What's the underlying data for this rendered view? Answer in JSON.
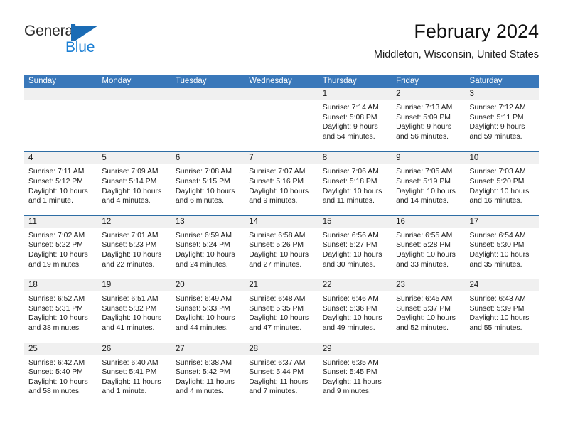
{
  "brand": {
    "word_one": "General",
    "word_two": "Blue",
    "mark": "triangle-logo",
    "accent_color": "#1b6cb5"
  },
  "header": {
    "title": "February 2024",
    "location": "Middleton, Wisconsin, United States"
  },
  "theme": {
    "header_blue": "#3a78ba",
    "rule_blue": "#2e6da4",
    "daynum_band": "#f0f0f0"
  },
  "weekdays": [
    "Sunday",
    "Monday",
    "Tuesday",
    "Wednesday",
    "Thursday",
    "Friday",
    "Saturday"
  ],
  "weeks": [
    [
      {
        "day": "",
        "sunrise": "",
        "sunset": "",
        "daylight_a": "",
        "daylight_b": ""
      },
      {
        "day": "",
        "sunrise": "",
        "sunset": "",
        "daylight_a": "",
        "daylight_b": ""
      },
      {
        "day": "",
        "sunrise": "",
        "sunset": "",
        "daylight_a": "",
        "daylight_b": ""
      },
      {
        "day": "",
        "sunrise": "",
        "sunset": "",
        "daylight_a": "",
        "daylight_b": ""
      },
      {
        "day": "1",
        "sunrise": "Sunrise: 7:14 AM",
        "sunset": "Sunset: 5:08 PM",
        "daylight_a": "Daylight: 9 hours",
        "daylight_b": "and 54 minutes."
      },
      {
        "day": "2",
        "sunrise": "Sunrise: 7:13 AM",
        "sunset": "Sunset: 5:09 PM",
        "daylight_a": "Daylight: 9 hours",
        "daylight_b": "and 56 minutes."
      },
      {
        "day": "3",
        "sunrise": "Sunrise: 7:12 AM",
        "sunset": "Sunset: 5:11 PM",
        "daylight_a": "Daylight: 9 hours",
        "daylight_b": "and 59 minutes."
      }
    ],
    [
      {
        "day": "4",
        "sunrise": "Sunrise: 7:11 AM",
        "sunset": "Sunset: 5:12 PM",
        "daylight_a": "Daylight: 10 hours",
        "daylight_b": "and 1 minute."
      },
      {
        "day": "5",
        "sunrise": "Sunrise: 7:09 AM",
        "sunset": "Sunset: 5:14 PM",
        "daylight_a": "Daylight: 10 hours",
        "daylight_b": "and 4 minutes."
      },
      {
        "day": "6",
        "sunrise": "Sunrise: 7:08 AM",
        "sunset": "Sunset: 5:15 PM",
        "daylight_a": "Daylight: 10 hours",
        "daylight_b": "and 6 minutes."
      },
      {
        "day": "7",
        "sunrise": "Sunrise: 7:07 AM",
        "sunset": "Sunset: 5:16 PM",
        "daylight_a": "Daylight: 10 hours",
        "daylight_b": "and 9 minutes."
      },
      {
        "day": "8",
        "sunrise": "Sunrise: 7:06 AM",
        "sunset": "Sunset: 5:18 PM",
        "daylight_a": "Daylight: 10 hours",
        "daylight_b": "and 11 minutes."
      },
      {
        "day": "9",
        "sunrise": "Sunrise: 7:05 AM",
        "sunset": "Sunset: 5:19 PM",
        "daylight_a": "Daylight: 10 hours",
        "daylight_b": "and 14 minutes."
      },
      {
        "day": "10",
        "sunrise": "Sunrise: 7:03 AM",
        "sunset": "Sunset: 5:20 PM",
        "daylight_a": "Daylight: 10 hours",
        "daylight_b": "and 16 minutes."
      }
    ],
    [
      {
        "day": "11",
        "sunrise": "Sunrise: 7:02 AM",
        "sunset": "Sunset: 5:22 PM",
        "daylight_a": "Daylight: 10 hours",
        "daylight_b": "and 19 minutes."
      },
      {
        "day": "12",
        "sunrise": "Sunrise: 7:01 AM",
        "sunset": "Sunset: 5:23 PM",
        "daylight_a": "Daylight: 10 hours",
        "daylight_b": "and 22 minutes."
      },
      {
        "day": "13",
        "sunrise": "Sunrise: 6:59 AM",
        "sunset": "Sunset: 5:24 PM",
        "daylight_a": "Daylight: 10 hours",
        "daylight_b": "and 24 minutes."
      },
      {
        "day": "14",
        "sunrise": "Sunrise: 6:58 AM",
        "sunset": "Sunset: 5:26 PM",
        "daylight_a": "Daylight: 10 hours",
        "daylight_b": "and 27 minutes."
      },
      {
        "day": "15",
        "sunrise": "Sunrise: 6:56 AM",
        "sunset": "Sunset: 5:27 PM",
        "daylight_a": "Daylight: 10 hours",
        "daylight_b": "and 30 minutes."
      },
      {
        "day": "16",
        "sunrise": "Sunrise: 6:55 AM",
        "sunset": "Sunset: 5:28 PM",
        "daylight_a": "Daylight: 10 hours",
        "daylight_b": "and 33 minutes."
      },
      {
        "day": "17",
        "sunrise": "Sunrise: 6:54 AM",
        "sunset": "Sunset: 5:30 PM",
        "daylight_a": "Daylight: 10 hours",
        "daylight_b": "and 35 minutes."
      }
    ],
    [
      {
        "day": "18",
        "sunrise": "Sunrise: 6:52 AM",
        "sunset": "Sunset: 5:31 PM",
        "daylight_a": "Daylight: 10 hours",
        "daylight_b": "and 38 minutes."
      },
      {
        "day": "19",
        "sunrise": "Sunrise: 6:51 AM",
        "sunset": "Sunset: 5:32 PM",
        "daylight_a": "Daylight: 10 hours",
        "daylight_b": "and 41 minutes."
      },
      {
        "day": "20",
        "sunrise": "Sunrise: 6:49 AM",
        "sunset": "Sunset: 5:33 PM",
        "daylight_a": "Daylight: 10 hours",
        "daylight_b": "and 44 minutes."
      },
      {
        "day": "21",
        "sunrise": "Sunrise: 6:48 AM",
        "sunset": "Sunset: 5:35 PM",
        "daylight_a": "Daylight: 10 hours",
        "daylight_b": "and 47 minutes."
      },
      {
        "day": "22",
        "sunrise": "Sunrise: 6:46 AM",
        "sunset": "Sunset: 5:36 PM",
        "daylight_a": "Daylight: 10 hours",
        "daylight_b": "and 49 minutes."
      },
      {
        "day": "23",
        "sunrise": "Sunrise: 6:45 AM",
        "sunset": "Sunset: 5:37 PM",
        "daylight_a": "Daylight: 10 hours",
        "daylight_b": "and 52 minutes."
      },
      {
        "day": "24",
        "sunrise": "Sunrise: 6:43 AM",
        "sunset": "Sunset: 5:39 PM",
        "daylight_a": "Daylight: 10 hours",
        "daylight_b": "and 55 minutes."
      }
    ],
    [
      {
        "day": "25",
        "sunrise": "Sunrise: 6:42 AM",
        "sunset": "Sunset: 5:40 PM",
        "daylight_a": "Daylight: 10 hours",
        "daylight_b": "and 58 minutes."
      },
      {
        "day": "26",
        "sunrise": "Sunrise: 6:40 AM",
        "sunset": "Sunset: 5:41 PM",
        "daylight_a": "Daylight: 11 hours",
        "daylight_b": "and 1 minute."
      },
      {
        "day": "27",
        "sunrise": "Sunrise: 6:38 AM",
        "sunset": "Sunset: 5:42 PM",
        "daylight_a": "Daylight: 11 hours",
        "daylight_b": "and 4 minutes."
      },
      {
        "day": "28",
        "sunrise": "Sunrise: 6:37 AM",
        "sunset": "Sunset: 5:44 PM",
        "daylight_a": "Daylight: 11 hours",
        "daylight_b": "and 7 minutes."
      },
      {
        "day": "29",
        "sunrise": "Sunrise: 6:35 AM",
        "sunset": "Sunset: 5:45 PM",
        "daylight_a": "Daylight: 11 hours",
        "daylight_b": "and 9 minutes."
      },
      {
        "day": "",
        "sunrise": "",
        "sunset": "",
        "daylight_a": "",
        "daylight_b": ""
      },
      {
        "day": "",
        "sunrise": "",
        "sunset": "",
        "daylight_a": "",
        "daylight_b": ""
      }
    ]
  ]
}
